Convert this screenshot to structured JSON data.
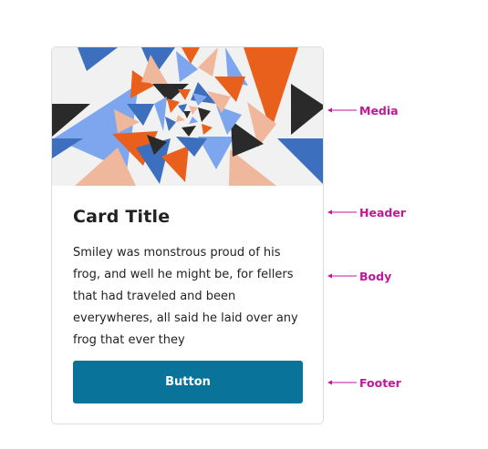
{
  "card": {
    "title": "Card Title",
    "body": "Smiley was monstrous proud of his frog, and well he might be, for fellers that had traveled and been everywheres, all said he laid over any frog that ever they",
    "button_label": "Button"
  },
  "annotations": {
    "media": "Media",
    "header": "Header",
    "body": "Body",
    "footer": "Footer"
  },
  "colors": {
    "annotation": "#c2169c",
    "button": "#0a7399",
    "pattern_orange": "#e8601c",
    "pattern_blue": "#3d6fbf",
    "pattern_light_blue": "#7da6ee",
    "pattern_peach": "#efb79b",
    "pattern_dark": "#2a2a2a"
  }
}
